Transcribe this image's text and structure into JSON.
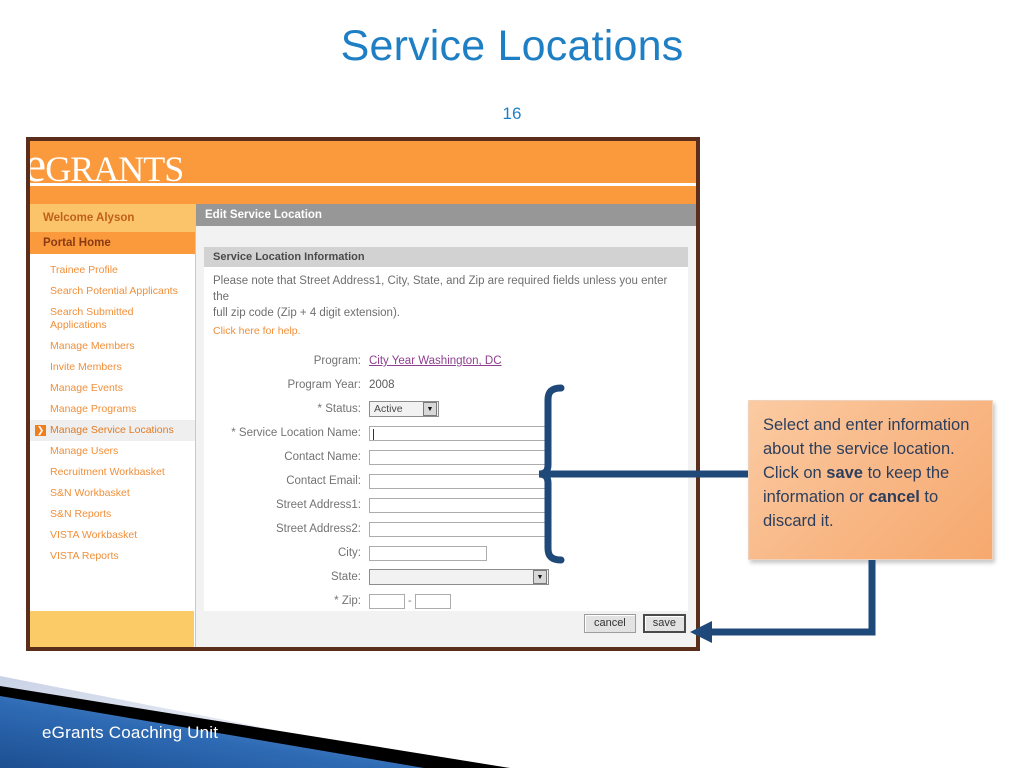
{
  "slide": {
    "title": "Service Locations",
    "number": "16",
    "footer": "eGrants Coaching Unit",
    "title_color": "#1F7FC4"
  },
  "app": {
    "brand": {
      "lead": "e",
      "rest": "GRANTS"
    },
    "sidebar": {
      "welcome": "Welcome Alyson",
      "portal_home": "Portal Home",
      "items": [
        {
          "label": "Trainee Profile",
          "active": false
        },
        {
          "label": "Search Potential Applicants",
          "active": false
        },
        {
          "label": "Search Submitted Applications",
          "active": false
        },
        {
          "label": "Manage Members",
          "active": false
        },
        {
          "label": "Invite Members",
          "active": false
        },
        {
          "label": "Manage Events",
          "active": false
        },
        {
          "label": "Manage Programs",
          "active": false
        },
        {
          "label": "Manage Service Locations",
          "active": true
        },
        {
          "label": "Manage Users",
          "active": false
        },
        {
          "label": "Recruitment Workbasket",
          "active": false
        },
        {
          "label": "S&N Workbasket",
          "active": false
        },
        {
          "label": "S&N Reports",
          "active": false
        },
        {
          "label": "VISTA Workbasket",
          "active": false
        },
        {
          "label": "VISTA Reports",
          "active": false
        }
      ]
    },
    "page_header": "Edit Service Location",
    "section_header": "Service Location Information",
    "note_line1": "Please note that Street Address1, City, State, and Zip are required fields unless you enter the",
    "note_line2": "full zip code (Zip + 4 digit extension).",
    "help_link": "Click here for help.",
    "form": {
      "program_label": "Program:",
      "program_value": "City Year Washington, DC",
      "program_year_label": "Program Year:",
      "program_year_value": "2008",
      "status_label": "* Status:",
      "status_value": "Active",
      "service_location_name_label": "* Service Location Name:",
      "service_location_name_value": "",
      "contact_name_label": "Contact Name:",
      "contact_name_value": "",
      "contact_email_label": "Contact Email:",
      "contact_email_value": "",
      "street1_label": "Street Address1:",
      "street1_value": "",
      "street2_label": "Street Address2:",
      "street2_value": "",
      "city_label": "City:",
      "city_value": "",
      "state_label": "State:",
      "state_value": "",
      "zip_label": "* Zip:",
      "zip_value": "",
      "zip_ext_value": "",
      "zip_separator": "-"
    },
    "buttons": {
      "cancel": "cancel",
      "save": "save"
    },
    "colors": {
      "brand_orange": "#FB9A3C",
      "sidebar_gold": "#FBCB68",
      "frame_border": "#5B2E1B",
      "header_gray": "#979797",
      "link_purple": "#8F3F8F",
      "link_orange": "#F08F3A"
    }
  },
  "annotation": {
    "text_part1": "Select and enter information about the service location. Click on ",
    "bold1": "save",
    "text_part2": " to keep the information or ",
    "bold2": "cancel",
    "text_part3": " to discard it.",
    "connector_color": "#1F4978"
  }
}
